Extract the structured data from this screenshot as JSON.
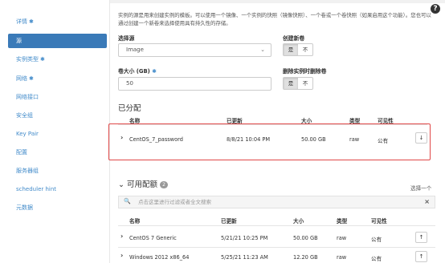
{
  "sidebar": {
    "items": [
      {
        "label": "详情",
        "required": true
      },
      {
        "label": "源",
        "required": false,
        "active": true
      },
      {
        "label": "实例类型",
        "required": true
      },
      {
        "label": "网络",
        "required": true
      },
      {
        "label": "网络接口",
        "required": false
      },
      {
        "label": "安全组",
        "required": false
      },
      {
        "label": "Key Pair",
        "required": false
      },
      {
        "label": "配置",
        "required": false
      },
      {
        "label": "服务器组",
        "required": false
      },
      {
        "label": "scheduler hint",
        "required": false
      },
      {
        "label": "元数据",
        "required": false
      }
    ]
  },
  "help_icon": "?",
  "main": {
    "intro_text": "实例的源是用来创建实例的模板。可以使用一个镜像、一个实例的快照（镜像快照）、一个卷或一个卷快照（如果启用这个功能）。您也可以通过创建一个新卷来选择使用具有持久性的存储。",
    "select_source": {
      "label": "选择源",
      "value": "Image"
    },
    "create_new_volume": {
      "label": "创建新卷",
      "yes": "是",
      "no": "不"
    },
    "volume_size": {
      "label": "卷大小 (GB)",
      "value": "50"
    },
    "delete_volume": {
      "label": "删除实例时删除卷",
      "yes": "是",
      "no": "不"
    }
  },
  "allocated": {
    "title": "已分配",
    "headers": {
      "name": "名称",
      "updated": "已更新",
      "size": "大小",
      "type": "类型",
      "visibility": "可见性"
    },
    "rows": [
      {
        "name": "CentOS_7_password",
        "updated": "8/8/21 10:04 PM",
        "size": "50.00 GB",
        "type": "raw",
        "visibility": "公有",
        "action": "↓"
      }
    ]
  },
  "available": {
    "title": "可用配额",
    "count": "2",
    "select_one": "选择一个",
    "search_placeholder": "点击这里进行过滤或者全文搜索",
    "headers": {
      "name": "名称",
      "updated": "已更新",
      "size": "大小",
      "type": "类型",
      "visibility": "可见性"
    },
    "rows": [
      {
        "name": "CentOS 7 Generic",
        "updated": "5/21/21 10:25 PM",
        "size": "50.00 GB",
        "type": "raw",
        "visibility": "公有",
        "action": "↑"
      },
      {
        "name": "Windows 2012 x86_64",
        "updated": "5/25/21 11:23 AM",
        "size": "12.20 GB",
        "type": "raw",
        "visibility": "公有",
        "action": "↑"
      }
    ]
  },
  "colors": {
    "accent": "#428bca",
    "active_bg": "#3a7ab8",
    "highlight": "#e04848"
  }
}
